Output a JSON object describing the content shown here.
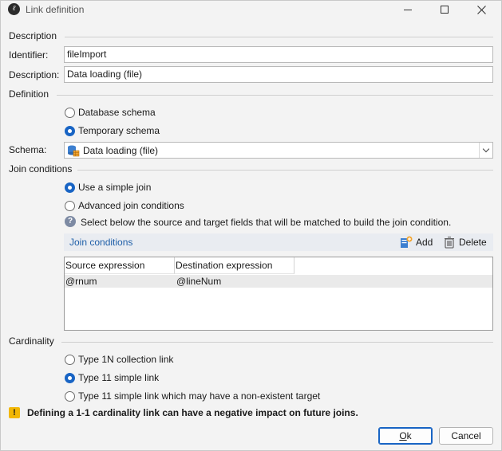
{
  "window": {
    "title": "Link definition",
    "app_icon_glyph": "ℓ"
  },
  "description_section": {
    "heading": "Description",
    "identifier_label": "Identifier:",
    "identifier_value": "fileImport",
    "description_label": "Description:",
    "description_value": "Data loading (file)"
  },
  "definition_section": {
    "heading": "Definition",
    "options": [
      {
        "label": "Database schema",
        "checked": false
      },
      {
        "label": "Temporary schema",
        "checked": true
      }
    ],
    "schema_label": "Schema:",
    "schema_value": "Data loading (file)",
    "schema_icon": "schema-table-icon"
  },
  "join_section": {
    "heading": "Join conditions",
    "options": [
      {
        "label": "Use a simple join",
        "checked": true
      },
      {
        "label": "Advanced join conditions",
        "checked": false
      }
    ],
    "help_text": "Select below the source and target fields that will be matched to build the join condition.",
    "toolbar_title": "Join conditions",
    "add_label": "Add",
    "delete_label": "Delete",
    "table": {
      "columns": [
        "Source expression",
        "Destination expression"
      ],
      "rows": [
        [
          "@rnum",
          "@lineNum"
        ]
      ]
    }
  },
  "cardinality_section": {
    "heading": "Cardinality",
    "options": [
      {
        "label": "Type 1N collection link",
        "checked": false
      },
      {
        "label": "Type 11 simple link",
        "checked": true
      },
      {
        "label": "Type 11 simple link which may have a non-existent target",
        "checked": false
      }
    ],
    "warning": "Defining a 1-1 cardinality link can have a negative impact on future joins."
  },
  "buttons": {
    "ok_mnemonic": "O",
    "ok_rest": "k",
    "cancel_label": "Cancel"
  },
  "colors": {
    "accent": "#1864c4",
    "link_blue": "#1f5fa8",
    "warning": "#f2b705",
    "selected_row": "#eaeaea"
  }
}
